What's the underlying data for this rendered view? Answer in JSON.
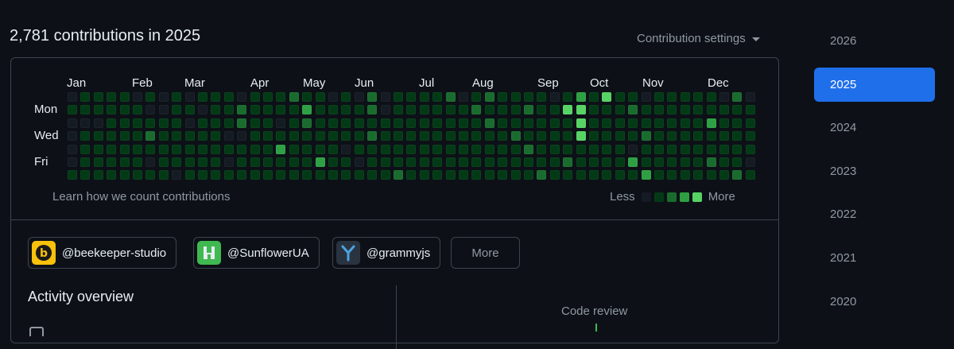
{
  "header": {
    "title": "2,781 contributions in 2025",
    "settings_label": "Contribution settings"
  },
  "graph": {
    "months": [
      "Jan",
      "Feb",
      "Mar",
      "Apr",
      "May",
      "Jun",
      "Jul",
      "Aug",
      "Sep",
      "Oct",
      "Nov",
      "Dec"
    ],
    "days": [
      "Mon",
      "Wed",
      "Fri"
    ],
    "learn_link": "Learn how we count contributions",
    "legend_less": "Less",
    "legend_more": "More",
    "colors": [
      "#151b23",
      "#033a16",
      "#196c2e",
      "#2ea043",
      "#56d364"
    ],
    "cells": [
      "01111010101110111211010201111201211110131411011111020",
      "11111100110112111131111201111112111211441112111111111",
      "00011111101112110121111111111111211111141111111113111",
      "01111121111100111111111211111111112111141111211111111",
      "01111111111111113111101111111111111211111110111111111",
      "01111101111101111113110111111111111111211113111112110",
      "11111111011111111111111112111111111121111111311111121"
    ]
  },
  "orgs": [
    {
      "label": "@beekeeper-studio",
      "logo": "beekeeper-logo",
      "bg": "#f8c10a"
    },
    {
      "label": "@SunflowerUA",
      "logo": "sunflower-logo",
      "bg": "#3fb950"
    },
    {
      "label": "@grammyjs",
      "logo": "grammy-logo",
      "bg": "#2a3340"
    }
  ],
  "more_label": "More",
  "activity_title": "Activity overview",
  "code_review_label": "Code review",
  "years": [
    "2026",
    "2025",
    "2024",
    "2023",
    "2022",
    "2021",
    "2020"
  ],
  "active_year": "2025"
}
